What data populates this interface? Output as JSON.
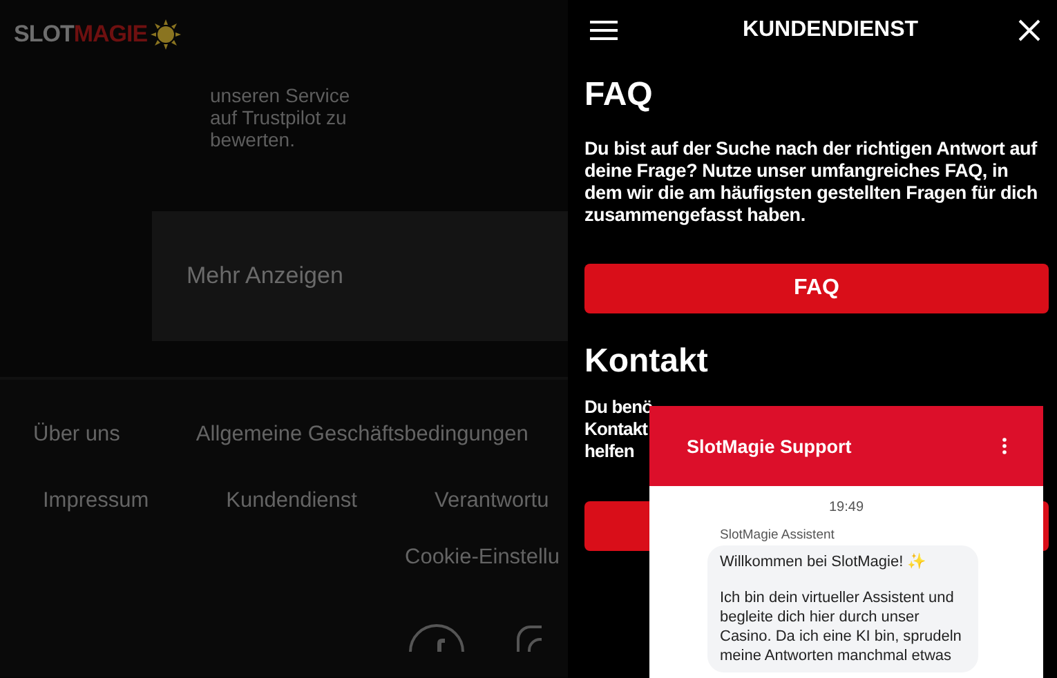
{
  "logo": {
    "part_1": "SLOT",
    "part_2": "MAGIE"
  },
  "background_page": {
    "trustpilot_text": [
      "unseren Service",
      "auf Trustpilot zu",
      "bewerten."
    ],
    "show_more": "Mehr Anzeigen",
    "footer_links": [
      {
        "label": "Über uns"
      },
      {
        "label": "Allgemeine Geschäftsbedingungen"
      },
      {
        "label": "Impressum"
      },
      {
        "label": "Kundendienst"
      },
      {
        "label": "Verantwortu"
      },
      {
        "label": "Cookie-Einstellu"
      }
    ]
  },
  "panel": {
    "title": "KUNDENDIENST",
    "faq": {
      "heading": "FAQ",
      "text": "Du bist auf der Suche nach der richtigen Antwort auf deine Frage? Nutze unser umfangreiches FAQ, in dem wir die am häufigsten gestellten Fragen für dich zusammengefasst haben.",
      "button": "FAQ"
    },
    "contact": {
      "heading": "Kontakt",
      "text_lines": [
        "Du benö",
        "Kontakt",
        "helfen"
      ]
    }
  },
  "chat": {
    "title": "SlotMagie Support",
    "time": "19:49",
    "sender": "SlotMagie Assistent",
    "message_title": "Willkommen bei SlotMagie! ✨",
    "message_body": "Ich bin dein virtueller Assistent und begleite dich hier durch unser Casino. Da ich eine KI bin, sprudeln meine Antworten manchmal etwas"
  }
}
